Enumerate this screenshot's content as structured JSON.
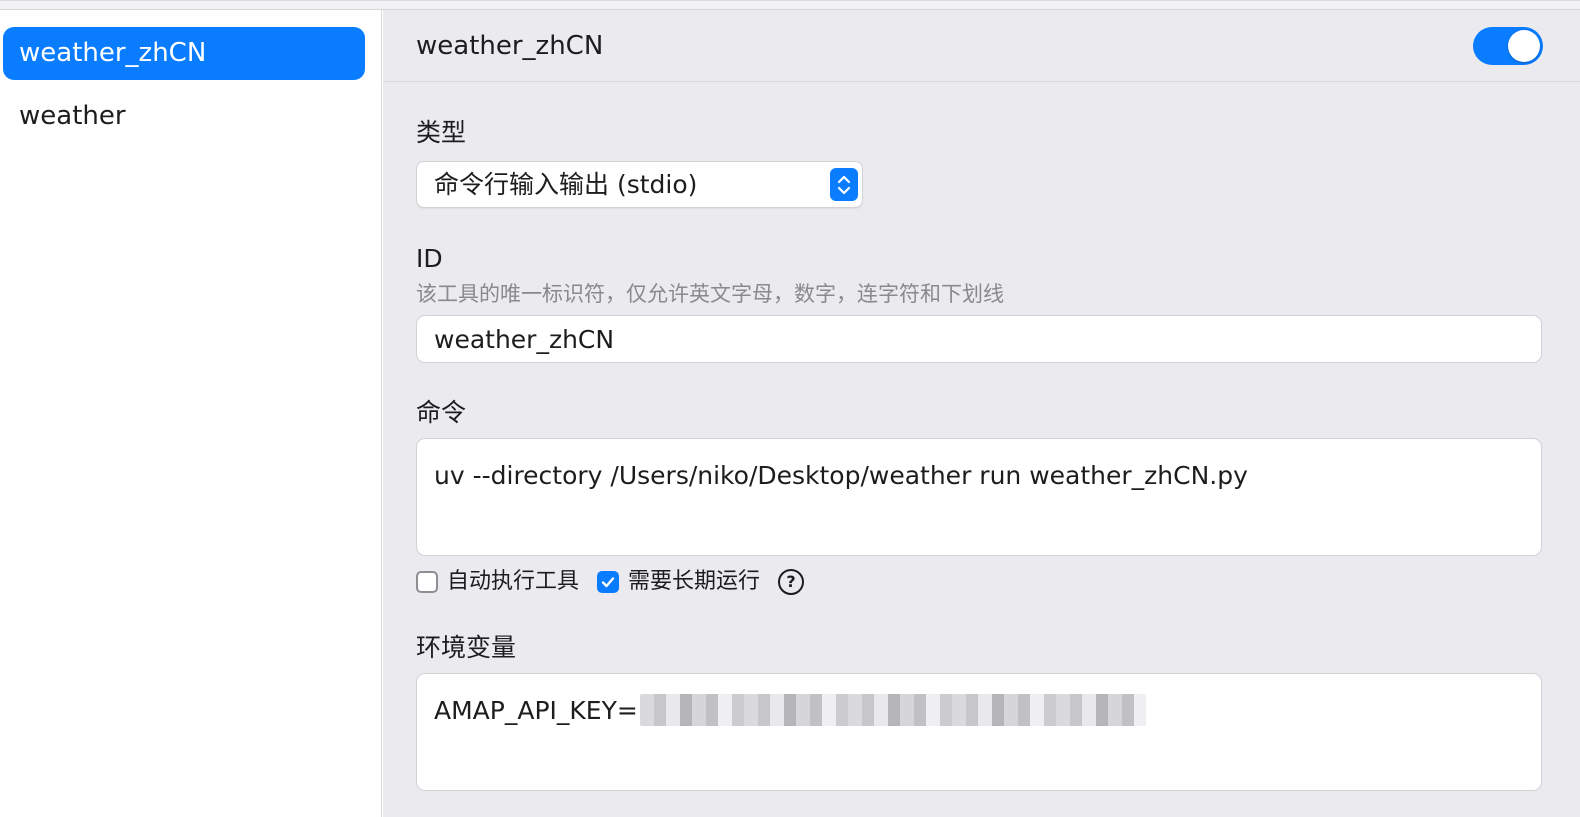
{
  "sidebar": {
    "items": [
      {
        "label": "weather_zhCN",
        "selected": true
      },
      {
        "label": "weather",
        "selected": false
      }
    ]
  },
  "header": {
    "title": "weather_zhCN",
    "enabled": true
  },
  "form": {
    "type": {
      "label": "类型",
      "value": "命令行输入输出 (stdio)"
    },
    "id": {
      "label": "ID",
      "hint": "该工具的唯一标识符，仅允许英文字母，数字，连字符和下划线",
      "value": "weather_zhCN"
    },
    "command": {
      "label": "命令",
      "value": "uv --directory /Users/niko/Desktop/weather run weather_zhCN.py"
    },
    "options": {
      "auto_execute_label": "自动执行工具",
      "auto_execute_checked": false,
      "long_running_label": "需要长期运行",
      "long_running_checked": true,
      "help_glyph": "?"
    },
    "env": {
      "label": "环境变量",
      "value_prefix": "AMAP_API_KEY="
    }
  },
  "colors": {
    "accent": "#0a7cff",
    "panel_bg": "#ebebef"
  }
}
